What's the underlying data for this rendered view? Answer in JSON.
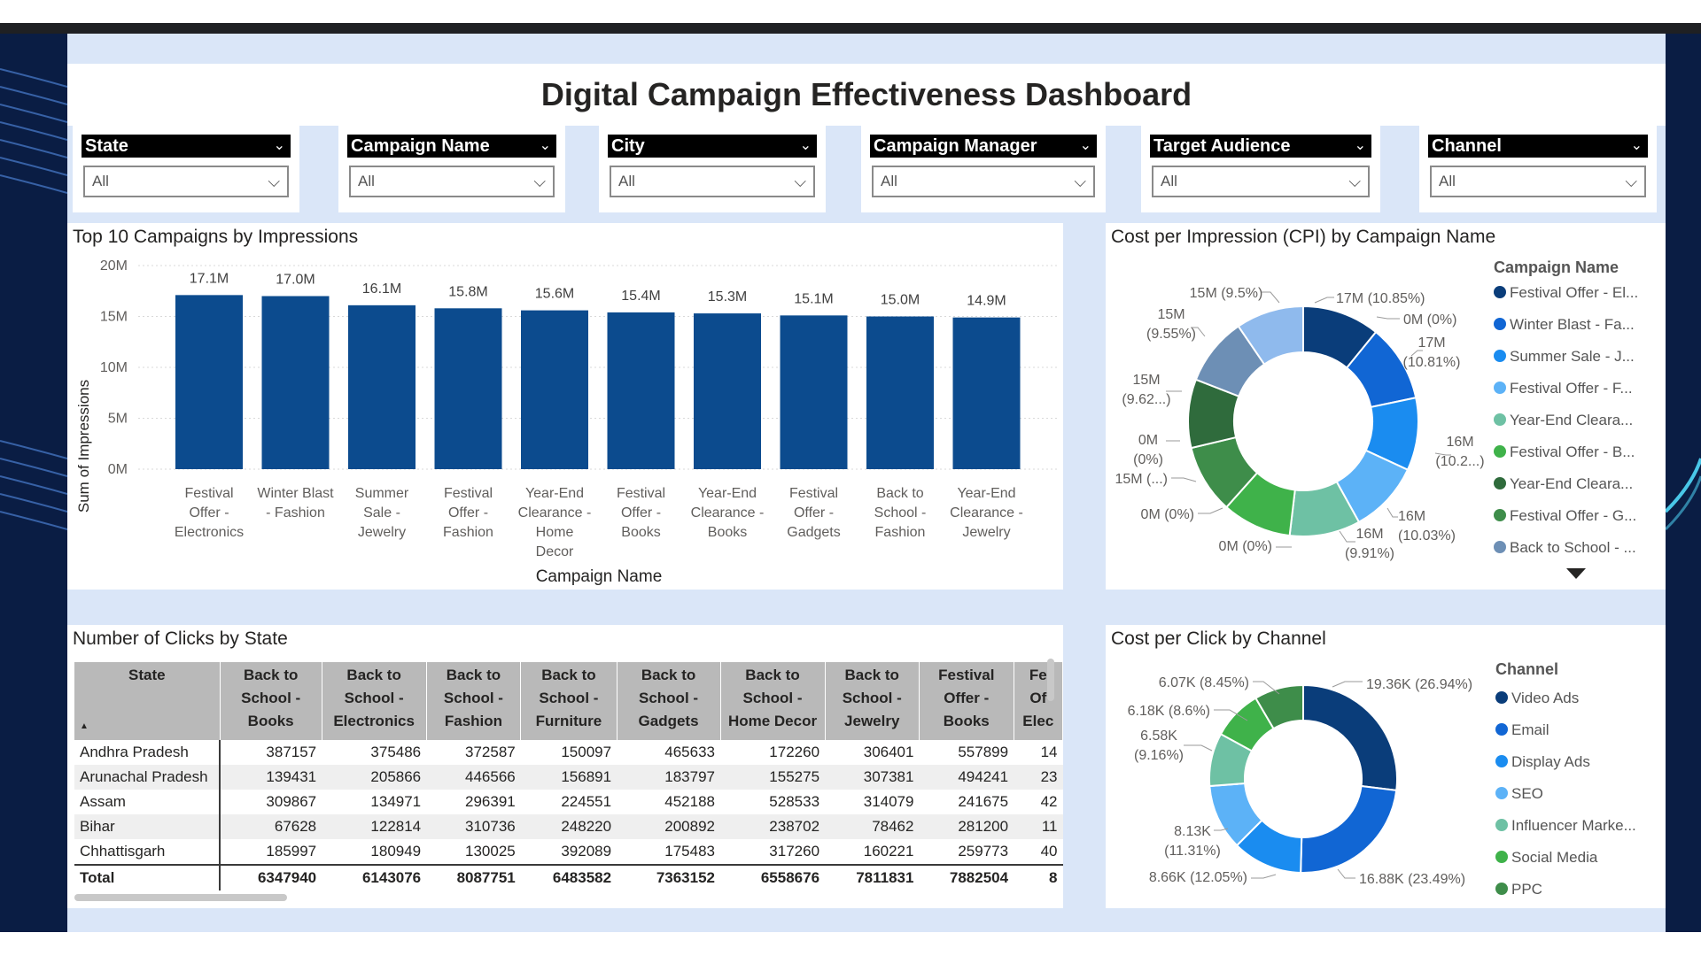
{
  "dashboard": {
    "title": "Digital Campaign Effectiveness Dashboard"
  },
  "slicers": [
    {
      "label": "State",
      "value": "All"
    },
    {
      "label": "Campaign Name",
      "value": "All"
    },
    {
      "label": "City",
      "value": "All"
    },
    {
      "label": "Campaign Manager",
      "value": "All"
    },
    {
      "label": "Target Audience",
      "value": "All"
    },
    {
      "label": "Channel",
      "value": "All"
    }
  ],
  "colors": {
    "bar": "#0c4b8e",
    "navy": "#0a1d44"
  },
  "bar_panel": {
    "title": "Top 10 Campaigns by Impressions"
  },
  "cpi_panel": {
    "title": "Cost per Impression (CPI) by Campaign Name"
  },
  "clicks_panel": {
    "title": "Number of Clicks by State"
  },
  "cpc_panel": {
    "title": "Cost per Click by Channel"
  },
  "chart_data": [
    {
      "type": "bar",
      "title": "Top 10 Campaigns by Impressions",
      "xlabel": "Campaign Name",
      "ylabel": "Sum of Impressions",
      "ylim": [
        0,
        20000000
      ],
      "yticks": [
        "0M",
        "5M",
        "10M",
        "15M",
        "20M"
      ],
      "grid": true,
      "categories": [
        "Festival Offer - Electronics",
        "Winter Blast - Fashion",
        "Summer Sale - Jewelry",
        "Festival Offer - Fashion",
        "Year-End Clearance - Home Decor",
        "Festival Offer - Books",
        "Year-End Clearance - Books",
        "Festival Offer - Gadgets",
        "Back to School - Fashion",
        "Year-End Clearance - Jewelry"
      ],
      "category_lines": [
        [
          "Festival",
          "Offer -",
          "Electronics"
        ],
        [
          "Winter Blast",
          "- Fashion"
        ],
        [
          "Summer",
          "Sale -",
          "Jewelry"
        ],
        [
          "Festival",
          "Offer -",
          "Fashion"
        ],
        [
          "Year-End",
          "Clearance -",
          "Home",
          "Decor"
        ],
        [
          "Festival",
          "Offer -",
          "Books"
        ],
        [
          "Year-End",
          "Clearance -",
          "Books"
        ],
        [
          "Festival",
          "Offer -",
          "Gadgets"
        ],
        [
          "Back to",
          "School -",
          "Fashion"
        ],
        [
          "Year-End",
          "Clearance -",
          "Jewelry"
        ]
      ],
      "values": [
        17100000,
        17000000,
        16100000,
        15800000,
        15600000,
        15400000,
        15300000,
        15100000,
        15000000,
        14900000
      ],
      "data_labels": [
        "17.1M",
        "17.0M",
        "16.1M",
        "15.8M",
        "15.6M",
        "15.4M",
        "15.3M",
        "15.1M",
        "15.0M",
        "14.9M"
      ]
    },
    {
      "type": "pie",
      "donut": true,
      "title": "Cost per Impression (CPI) by Campaign Name",
      "legend_title": "Campaign Name",
      "legend_placement": "right",
      "legend": [
        "Festival Offer - El...",
        "Winter Blast - Fa...",
        "Summer Sale - J...",
        "Festival Offer - F...",
        "Year-End Cleara...",
        "Festival Offer - B...",
        "Year-End Cleara...",
        "Festival Offer - G...",
        "Back to School - ..."
      ],
      "slices": [
        {
          "value": 10.85,
          "color": "#0a3d7a",
          "label": "17M (10.85%)"
        },
        {
          "value": 0.0,
          "color": "#0a3d7a",
          "label": "0M (0%)"
        },
        {
          "value": 10.81,
          "color": "#1166d4",
          "label": "17M (10.81%)"
        },
        {
          "value": 10.2,
          "color": "#1a8cf0",
          "label": "16M (10.2...)"
        },
        {
          "value": 10.03,
          "color": "#5cb2f7",
          "label": "16M (10.03%)"
        },
        {
          "value": 9.91,
          "color": "#6ec1a4",
          "label": "16M (9.91%)"
        },
        {
          "value": 0.0,
          "color": "#6ec1a4",
          "label": "0M (0%)"
        },
        {
          "value": 9.7,
          "color": "#3fb24a",
          "label": "0M (0%)"
        },
        {
          "value": 9.66,
          "color": "#3e8d4a",
          "label": "15M (...)"
        },
        {
          "value": 0.0,
          "color": "#3e8d4a",
          "label": "0M (0%)"
        },
        {
          "value": 9.62,
          "color": "#2f6b3c",
          "label": "15M (9.62...)"
        },
        {
          "value": 9.55,
          "color": "#6d8fb5",
          "label": "15M (9.55%)"
        },
        {
          "value": 9.5,
          "color": "#8fbaed",
          "label": "15M (9.5%)"
        }
      ]
    },
    {
      "type": "table",
      "title": "Number of Clicks by State",
      "columns": [
        [
          "State"
        ],
        [
          "Back to",
          "School -",
          "Books"
        ],
        [
          "Back to",
          "School -",
          "Electronics"
        ],
        [
          "Back to",
          "School -",
          "Fashion"
        ],
        [
          "Back to",
          "School -",
          "Furniture"
        ],
        [
          "Back to",
          "School -",
          "Gadgets"
        ],
        [
          "Back to",
          "School -",
          "Home Decor"
        ],
        [
          "Back to",
          "School -",
          "Jewelry"
        ],
        [
          "Festival",
          "Offer -",
          "Books"
        ],
        [
          "Fe",
          "Of",
          "Elec"
        ]
      ],
      "rows": [
        [
          "Andhra Pradesh",
          "387157",
          "375486",
          "372587",
          "150097",
          "465633",
          "172260",
          "306401",
          "557899",
          "14"
        ],
        [
          "Arunachal Pradesh",
          "139431",
          "205866",
          "446566",
          "156891",
          "183797",
          "155275",
          "307381",
          "494241",
          "23"
        ],
        [
          "Assam",
          "309867",
          "134971",
          "296391",
          "224551",
          "452188",
          "528533",
          "314079",
          "241675",
          "42"
        ],
        [
          "Bihar",
          "67628",
          "122814",
          "310736",
          "248220",
          "200892",
          "238702",
          "78462",
          "281200",
          "11"
        ],
        [
          "Chhattisgarh",
          "185997",
          "180949",
          "130025",
          "392089",
          "175483",
          "317260",
          "160221",
          "259773",
          "40"
        ]
      ],
      "total": [
        "Total",
        "6347940",
        "6143076",
        "8087751",
        "6483582",
        "7363152",
        "6558676",
        "7811831",
        "7882504",
        "8"
      ]
    },
    {
      "type": "pie",
      "donut": true,
      "title": "Cost per Click by Channel",
      "legend_title": "Channel",
      "legend_placement": "right",
      "legend": [
        "Video Ads",
        "Email",
        "Display Ads",
        "SEO",
        "Influencer Marke...",
        "Social Media",
        "PPC"
      ],
      "slices": [
        {
          "value": 26.94,
          "color": "#0a3d7a",
          "label": "19.36K (26.94%)"
        },
        {
          "value": 23.49,
          "color": "#1166d4",
          "label": "16.88K (23.49%)"
        },
        {
          "value": 12.05,
          "color": "#1a8cf0",
          "label": "8.66K (12.05%)"
        },
        {
          "value": 11.31,
          "color": "#5cb2f7",
          "label": "8.13K (11.31%)"
        },
        {
          "value": 9.16,
          "color": "#6ec1a4",
          "label": "6.58K (9.16%)"
        },
        {
          "value": 8.6,
          "color": "#3fb24a",
          "label": "6.18K (8.6%)"
        },
        {
          "value": 8.45,
          "color": "#3e8d4a",
          "label": "6.07K (8.45%)"
        }
      ]
    }
  ]
}
